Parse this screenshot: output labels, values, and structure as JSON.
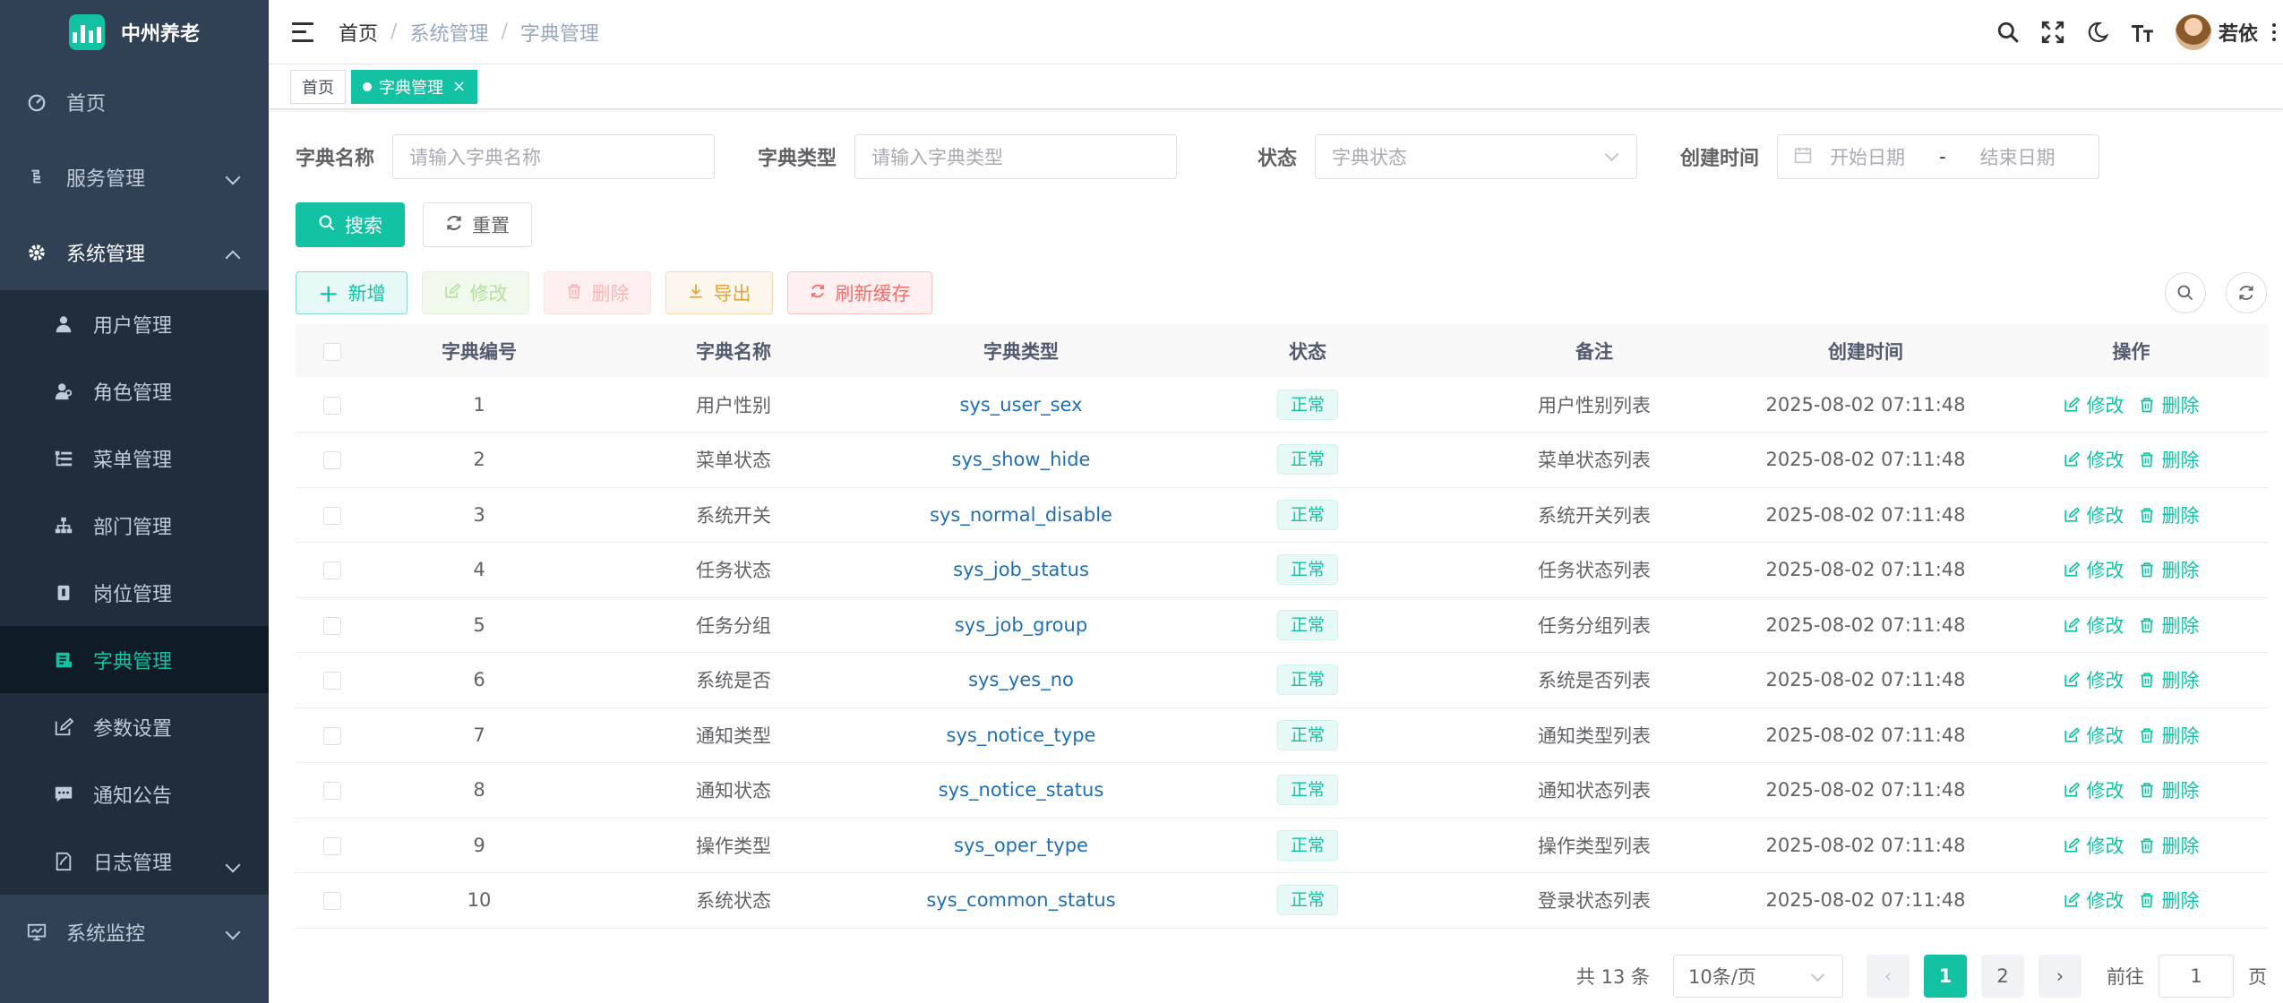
{
  "app": {
    "name": "中州养老"
  },
  "sidebar": {
    "items": [
      {
        "label": "首页",
        "icon": "dashboard-icon"
      },
      {
        "label": "服务管理",
        "icon": "service-icon"
      },
      {
        "label": "系统管理",
        "icon": "gear-icon"
      },
      {
        "label": "系统监控",
        "icon": "monitor-icon"
      }
    ],
    "sub_items": [
      {
        "label": "用户管理",
        "icon": "user-icon"
      },
      {
        "label": "角色管理",
        "icon": "role-icon"
      },
      {
        "label": "菜单管理",
        "icon": "menu-tree-icon"
      },
      {
        "label": "部门管理",
        "icon": "org-chart-icon"
      },
      {
        "label": "岗位管理",
        "icon": "post-icon"
      },
      {
        "label": "字典管理",
        "icon": "dictionary-icon"
      },
      {
        "label": "参数设置",
        "icon": "edit-icon"
      },
      {
        "label": "通知公告",
        "icon": "message-icon"
      },
      {
        "label": "日志管理",
        "icon": "log-icon"
      }
    ]
  },
  "navbar": {
    "breadcrumb": [
      "首页",
      "系统管理",
      "字典管理"
    ],
    "user_name": "若依",
    "icons": [
      "search-icon",
      "fullscreen-icon",
      "moon-icon",
      "font-size-icon"
    ]
  },
  "tags": [
    {
      "label": "首页"
    },
    {
      "label": "字典管理"
    }
  ],
  "search_form": {
    "dict_name_label": "字典名称",
    "dict_name_placeholder": "请输入字典名称",
    "dict_type_label": "字典类型",
    "dict_type_placeholder": "请输入字典类型",
    "status_label": "状态",
    "status_placeholder": "字典状态",
    "create_time_label": "创建时间",
    "start_placeholder": "开始日期",
    "range_sep": "-",
    "end_placeholder": "结束日期",
    "search_button": "搜索",
    "reset_button": "重置"
  },
  "toolbar": {
    "add": "新增",
    "edit": "修改",
    "delete": "删除",
    "export": "导出",
    "refresh_cache": "刷新缓存"
  },
  "table": {
    "columns": [
      "字典编号",
      "字典名称",
      "字典类型",
      "状态",
      "备注",
      "创建时间",
      "操作"
    ],
    "edit_label": "修改",
    "delete_label": "删除",
    "rows": [
      {
        "id": "1",
        "name": "用户性别",
        "type": "sys_user_sex",
        "status": "正常",
        "remark": "用户性别列表",
        "time": "2025-08-02 07:11:48"
      },
      {
        "id": "2",
        "name": "菜单状态",
        "type": "sys_show_hide",
        "status": "正常",
        "remark": "菜单状态列表",
        "time": "2025-08-02 07:11:48"
      },
      {
        "id": "3",
        "name": "系统开关",
        "type": "sys_normal_disable",
        "status": "正常",
        "remark": "系统开关列表",
        "time": "2025-08-02 07:11:48"
      },
      {
        "id": "4",
        "name": "任务状态",
        "type": "sys_job_status",
        "status": "正常",
        "remark": "任务状态列表",
        "time": "2025-08-02 07:11:48"
      },
      {
        "id": "5",
        "name": "任务分组",
        "type": "sys_job_group",
        "status": "正常",
        "remark": "任务分组列表",
        "time": "2025-08-02 07:11:48"
      },
      {
        "id": "6",
        "name": "系统是否",
        "type": "sys_yes_no",
        "status": "正常",
        "remark": "系统是否列表",
        "time": "2025-08-02 07:11:48"
      },
      {
        "id": "7",
        "name": "通知类型",
        "type": "sys_notice_type",
        "status": "正常",
        "remark": "通知类型列表",
        "time": "2025-08-02 07:11:48"
      },
      {
        "id": "8",
        "name": "通知状态",
        "type": "sys_notice_status",
        "status": "正常",
        "remark": "通知状态列表",
        "time": "2025-08-02 07:11:48"
      },
      {
        "id": "9",
        "name": "操作类型",
        "type": "sys_oper_type",
        "status": "正常",
        "remark": "操作类型列表",
        "time": "2025-08-02 07:11:48"
      },
      {
        "id": "10",
        "name": "系统状态",
        "type": "sys_common_status",
        "status": "正常",
        "remark": "登录状态列表",
        "time": "2025-08-02 07:11:48"
      }
    ]
  },
  "pagination": {
    "total_text": "共 13 条",
    "page_size": "10条/页",
    "pages": [
      "1",
      "2"
    ],
    "prev": "‹",
    "next": "›",
    "goto_label": "前往",
    "goto_value": "1",
    "goto_suffix": "页"
  },
  "colors": {
    "primary": "#13c2a3",
    "sidebar_bg": "#304156",
    "sidebar_active_bg": "#0f1c28"
  }
}
